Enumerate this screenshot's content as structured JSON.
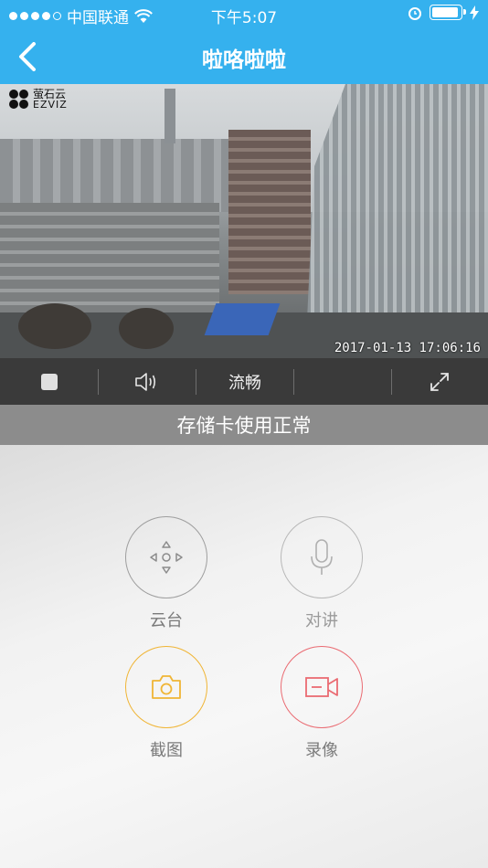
{
  "status_bar": {
    "carrier": "中国联通",
    "time": "下午5:07",
    "icons": [
      "signal-dots-icon",
      "wifi-icon",
      "alarm-icon",
      "battery-icon",
      "charging-bolt-icon"
    ]
  },
  "nav": {
    "title": "啦咯啦啦",
    "back_icon": "chevron-left-icon"
  },
  "video": {
    "logo_text_top": "萤石云",
    "logo_text_bottom": "EZVIZ",
    "timestamp": "2017-01-13 17:06:16"
  },
  "controls": {
    "stop_icon": "stop-square-icon",
    "volume_icon": "speaker-icon",
    "quality_label": "流畅",
    "fullscreen_icon": "expand-icon"
  },
  "banner": {
    "text": "存储卡使用正常"
  },
  "actions": {
    "ptz_label": "云台",
    "talk_label": "对讲",
    "snapshot_label": "截图",
    "record_label": "录像"
  },
  "colors": {
    "primary_blue": "#35b1ee",
    "control_bar": "#3a3a3a",
    "banner": "#8c8c8c",
    "snapshot_accent": "#f0b535",
    "record_accent": "#ea6b72"
  }
}
